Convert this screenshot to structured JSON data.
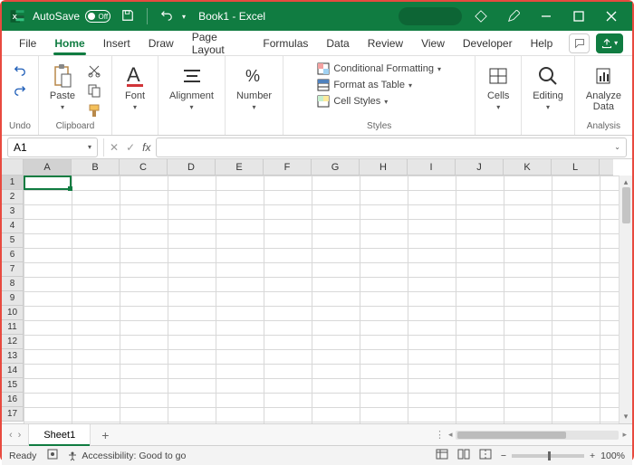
{
  "title": {
    "autosave_label": "AutoSave",
    "autosave_state": "Off",
    "doc": "Book1 - Excel"
  },
  "tabs": [
    "File",
    "Home",
    "Insert",
    "Draw",
    "Page Layout",
    "Formulas",
    "Data",
    "Review",
    "View",
    "Developer",
    "Help"
  ],
  "active_tab": "Home",
  "ribbon": {
    "undo": "Undo",
    "clipboard": {
      "label": "Clipboard",
      "paste": "Paste"
    },
    "font": "Font",
    "alignment": "Alignment",
    "number": "Number",
    "styles": {
      "label": "Styles",
      "cond": "Conditional Formatting",
      "table": "Format as Table",
      "cell": "Cell Styles"
    },
    "cells": "Cells",
    "editing": "Editing",
    "analysis": {
      "label": "Analysis",
      "analyze": "Analyze",
      "data": "Data"
    }
  },
  "namebox": "A1",
  "columns": [
    "A",
    "B",
    "C",
    "D",
    "E",
    "F",
    "G",
    "H",
    "I",
    "J",
    "K",
    "L"
  ],
  "rows": [
    "1",
    "2",
    "3",
    "4",
    "5",
    "6",
    "7",
    "8",
    "9",
    "10",
    "11",
    "12",
    "13",
    "14",
    "15",
    "16",
    "17"
  ],
  "sheet": {
    "name": "Sheet1"
  },
  "status": {
    "ready": "Ready",
    "access": "Accessibility: Good to go",
    "zoom": "100%"
  }
}
